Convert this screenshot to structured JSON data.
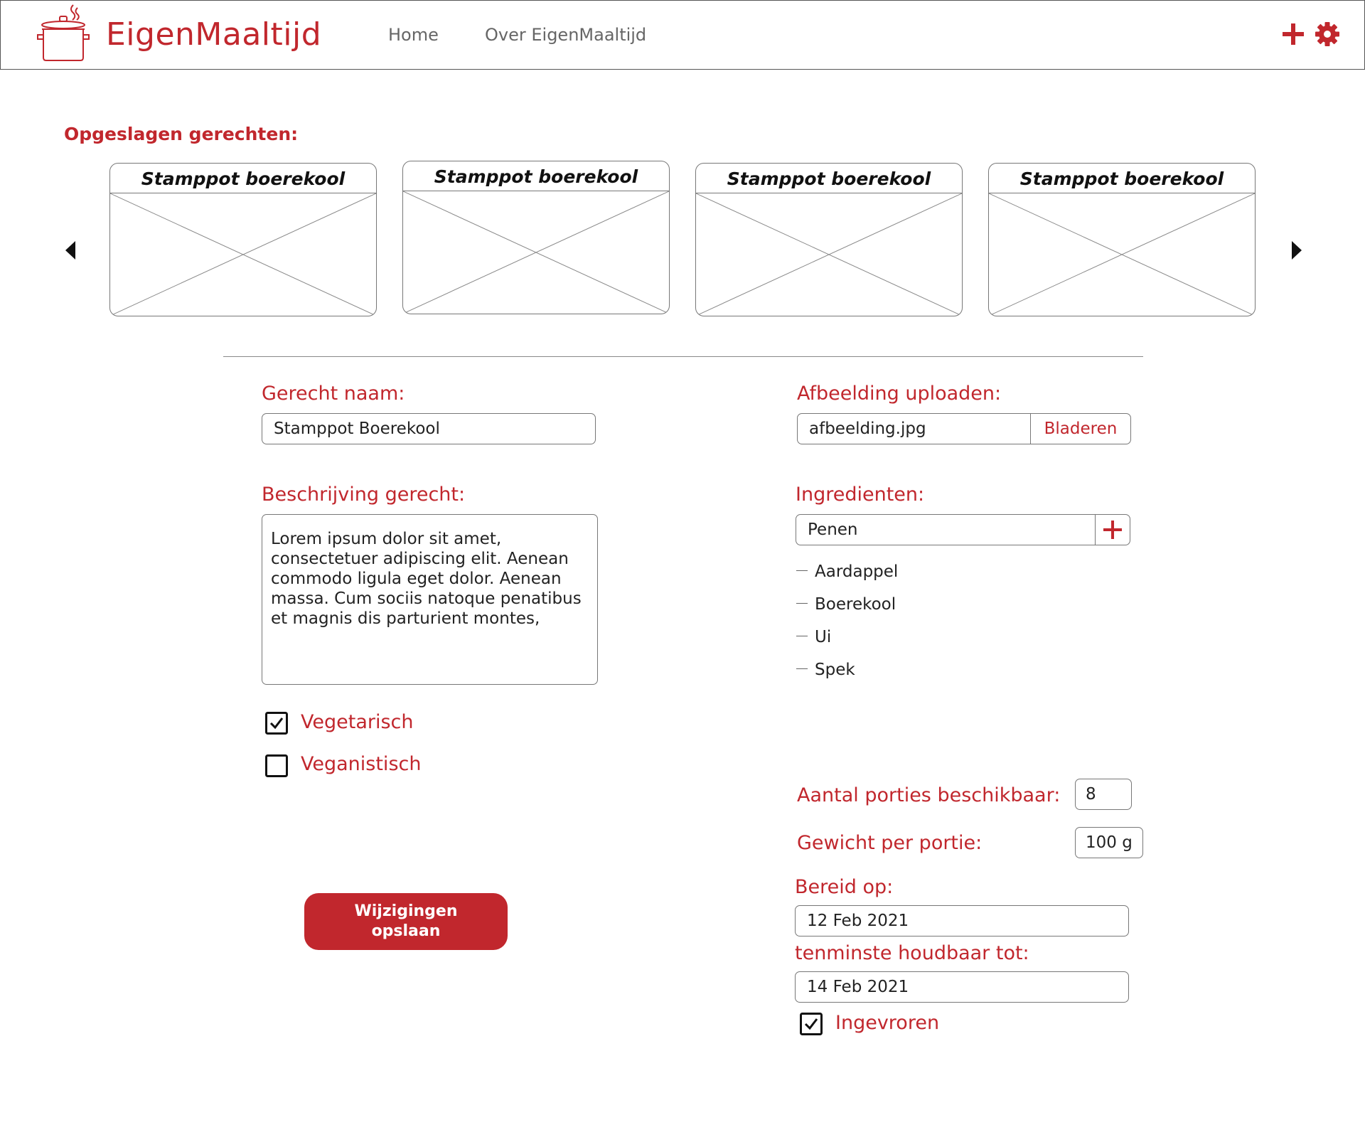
{
  "header": {
    "app_name": "EigenMaaltijd",
    "nav": [
      "Home",
      "Over EigenMaaltijd"
    ],
    "icons": [
      "plus-icon",
      "gear-icon"
    ]
  },
  "saved": {
    "title": "Opgeslagen gerechten:",
    "cards": [
      {
        "title": "Stamppot boerekool"
      },
      {
        "title": "Stamppot boerekool"
      },
      {
        "title": "Stamppot boerekool"
      },
      {
        "title": "Stamppot boerekool"
      }
    ]
  },
  "form": {
    "dish_name_label": "Gerecht naam:",
    "dish_name_value": "Stamppot Boerekool",
    "description_label": "Beschrijving gerecht:",
    "description_value": "Lorem ipsum dolor sit amet, consectetuer adipiscing elit. Aenean commodo ligula eget dolor. Aenean massa. Cum sociis natoque penatibus et magnis dis parturient montes,",
    "vegetarian_label": "Vegetarisch",
    "vegetarian_checked": true,
    "vegan_label": "Veganistisch",
    "vegan_checked": false,
    "save_label": "Wijzigingen\nopslaan",
    "image_label": "Afbeelding uploaden:",
    "image_value": "afbeelding.jpg",
    "browse_label": "Bladeren",
    "ingredients_label": "Ingredienten:",
    "ingredient_input_value": "Penen",
    "ingredients": [
      "Aardappel",
      "Boerekool",
      "Ui",
      "Spek"
    ],
    "portions_label": "Aantal porties beschikbaar:",
    "portions_value": "8",
    "weight_label": "Gewicht per portie:",
    "weight_value": "100 g",
    "prepared_label": "Bereid op:",
    "prepared_value": "12 Feb 2021",
    "best_before_label": "tenminste houdbaar tot:",
    "best_before_value": "14 Feb 2021",
    "frozen_label": "Ingevroren",
    "frozen_checked": true
  },
  "colors": {
    "accent": "#c1272d"
  }
}
